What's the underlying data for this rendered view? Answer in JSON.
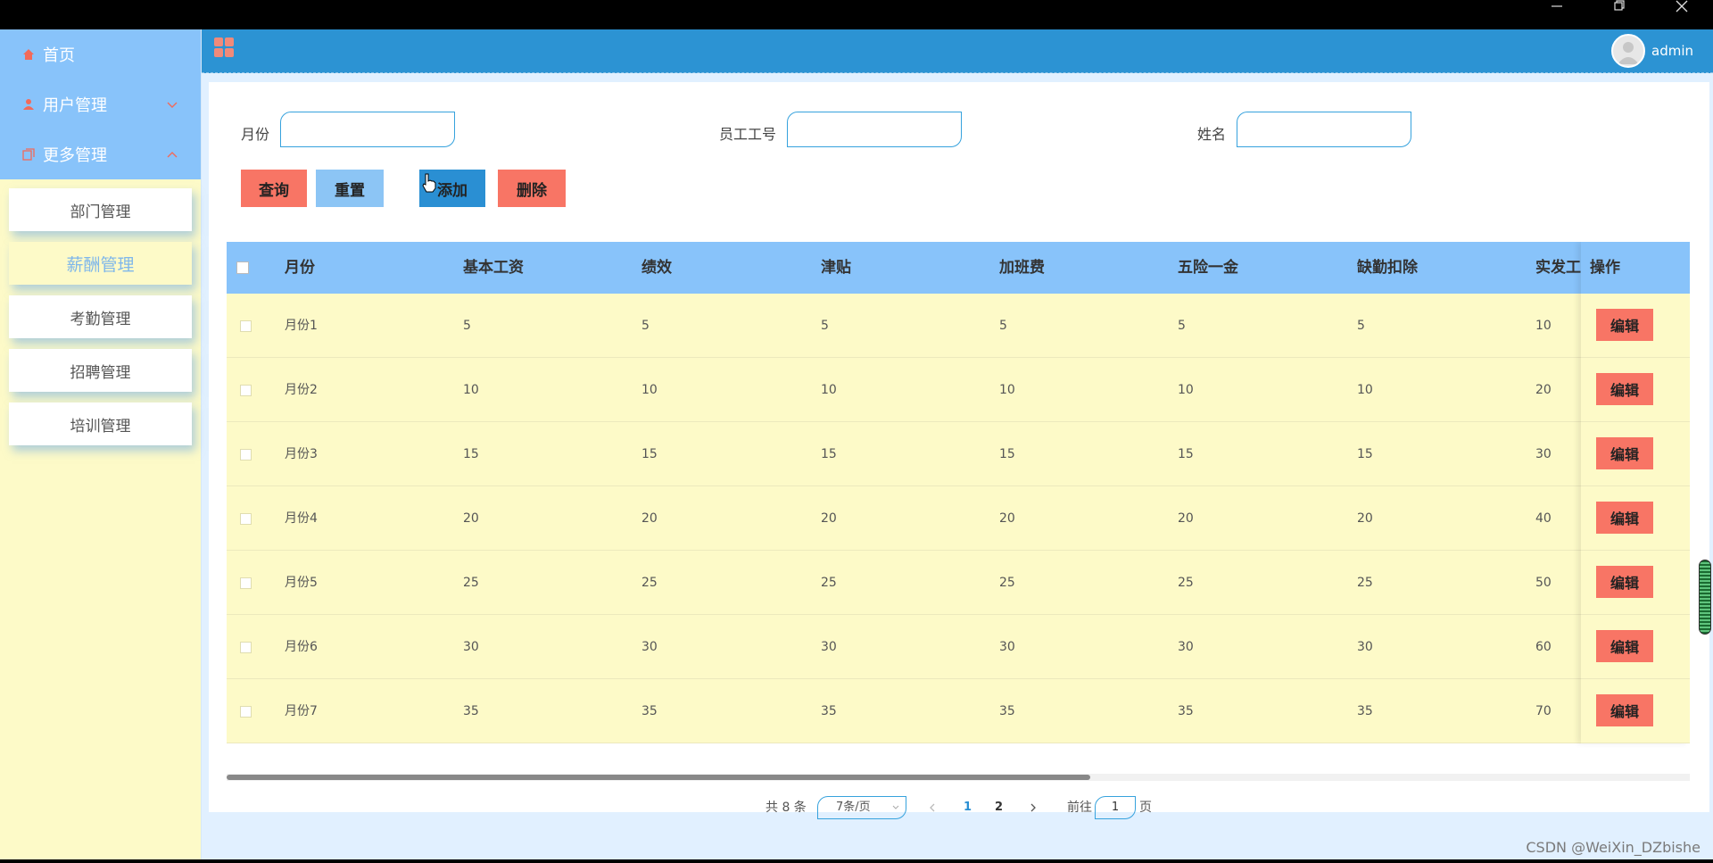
{
  "sidebar": {
    "menu": [
      {
        "label": "首页",
        "icon": "home-icon"
      },
      {
        "label": "用户管理",
        "icon": "user-icon"
      },
      {
        "label": "更多管理",
        "icon": "list-icon"
      }
    ],
    "submenu": [
      {
        "label": "部门管理",
        "active": false
      },
      {
        "label": "薪酬管理",
        "active": true
      },
      {
        "label": "考勤管理",
        "active": false
      },
      {
        "label": "招聘管理",
        "active": false
      },
      {
        "label": "培训管理",
        "active": false
      }
    ]
  },
  "header": {
    "username": "admin",
    "accent": "#2c93d3"
  },
  "search": {
    "month_label": "月份",
    "month_value": "",
    "employee_id_label": "员工工号",
    "employee_id_value": "",
    "name_label": "姓名",
    "name_value": ""
  },
  "buttons": {
    "query": "查询",
    "reset": "重置",
    "add": "添加",
    "delete": "删除"
  },
  "table": {
    "columns": [
      "月份",
      "基本工资",
      "绩效",
      "津贴",
      "加班费",
      "五险一金",
      "缺勤扣除",
      "实发工"
    ],
    "op_column": "操作",
    "edit_label": "编辑",
    "rows": [
      [
        "月份1",
        "5",
        "5",
        "5",
        "5",
        "5",
        "5",
        "10"
      ],
      [
        "月份2",
        "10",
        "10",
        "10",
        "10",
        "10",
        "10",
        "20"
      ],
      [
        "月份3",
        "15",
        "15",
        "15",
        "15",
        "15",
        "15",
        "30"
      ],
      [
        "月份4",
        "20",
        "20",
        "20",
        "20",
        "20",
        "20",
        "40"
      ],
      [
        "月份5",
        "25",
        "25",
        "25",
        "25",
        "25",
        "25",
        "50"
      ],
      [
        "月份6",
        "30",
        "30",
        "30",
        "30",
        "30",
        "30",
        "60"
      ],
      [
        "月份7",
        "35",
        "35",
        "35",
        "35",
        "35",
        "35",
        "70"
      ]
    ]
  },
  "pagination": {
    "total": "共 8 条",
    "page_size": "7条/页",
    "pages": [
      "1",
      "2"
    ],
    "current_page": "1",
    "goto_label": "前往",
    "goto_value": "1",
    "page_suffix": "页"
  },
  "watermark": "CSDN @WeiXin_DZbishe",
  "colors": {
    "sidebar_bg": "#fdfac8",
    "menu_bg": "#88c3fa",
    "table_head": "#88c3fa",
    "danger": "#f87565"
  }
}
